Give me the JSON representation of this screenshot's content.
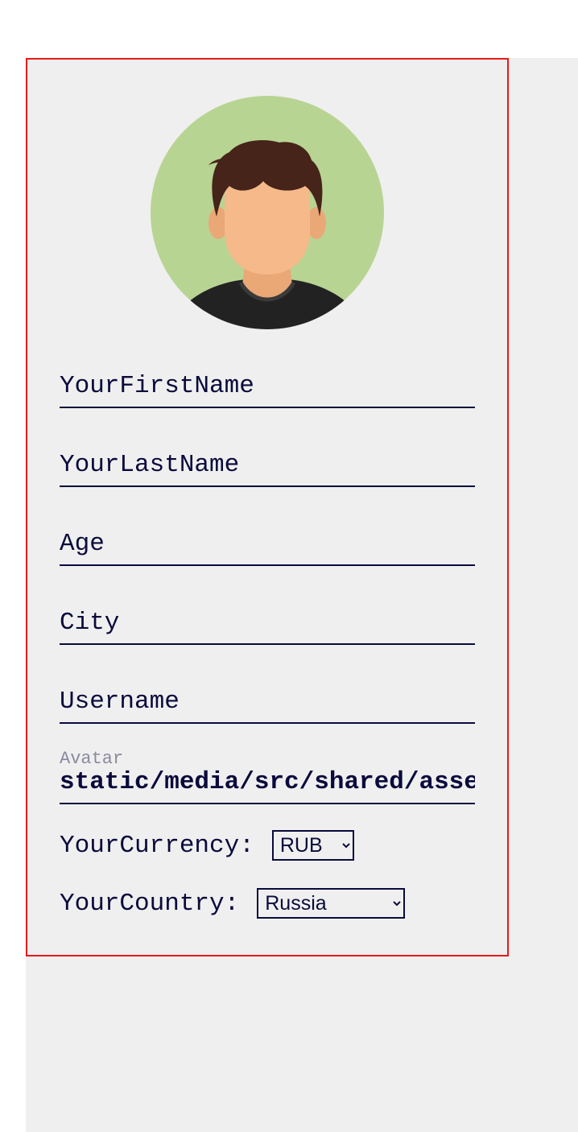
{
  "form": {
    "first_name": {
      "placeholder": "YourFirstName",
      "value": ""
    },
    "last_name": {
      "placeholder": "YourLastName",
      "value": ""
    },
    "age": {
      "placeholder": "Age",
      "value": ""
    },
    "city": {
      "placeholder": "City",
      "value": ""
    },
    "username": {
      "placeholder": "Username",
      "value": ""
    },
    "avatar": {
      "label": "Avatar",
      "value": "static/media/src/shared/assets/avatar.png"
    },
    "currency": {
      "label": "YourCurrency:",
      "selected": "RUB",
      "options": [
        "RUB"
      ]
    },
    "country": {
      "label": "YourCountry:",
      "selected": "Russia",
      "options": [
        "Russia"
      ]
    }
  },
  "icons": {
    "profile_avatar": "person-avatar-icon"
  },
  "colors": {
    "border": "#e81818",
    "text": "#0a0a3c",
    "panel": "#efefef",
    "avatar_bg": "#b8d493"
  }
}
